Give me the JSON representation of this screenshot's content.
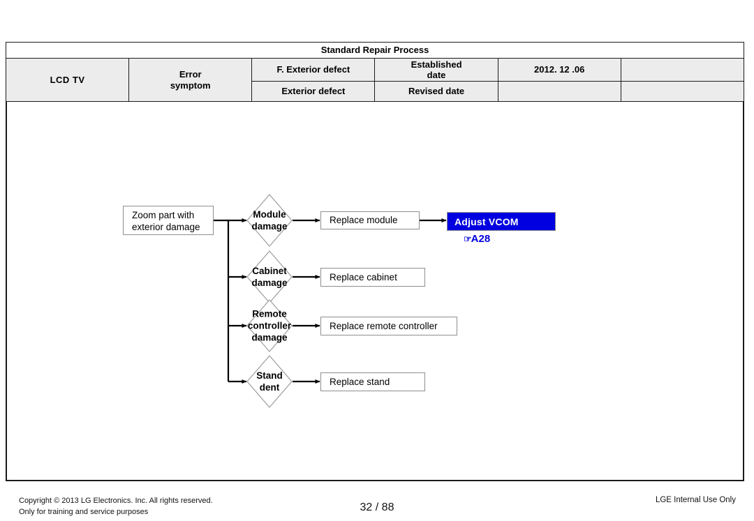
{
  "header": {
    "banner": "Standard Repair Process",
    "product": "LCD  TV",
    "error_symptom": "Error\nsymptom",
    "error_symptom_line1": "Error",
    "error_symptom_line2": "symptom",
    "main_title": "F. Exterior defect",
    "sub_title": "Exterior defect",
    "established_label_line1": "Established",
    "established_label_line2": "date",
    "established_value": "2012. 12 .06",
    "revised_label": "Revised date",
    "revised_value": "",
    "extra_cell_top": "",
    "extra_cell_bottom": ""
  },
  "flowchart": {
    "start": {
      "line1": "Zoom part with",
      "line2": "exterior damage"
    },
    "branches": [
      {
        "decision_line1": "Module",
        "decision_line2": "damage",
        "action": "Replace module"
      },
      {
        "decision_line1": "Cabinet",
        "decision_line2": "damage",
        "action": "Replace cabinet"
      },
      {
        "decision_line1": "Remote",
        "decision_line2": "controller",
        "decision_line3": "damage",
        "action": "Replace remote controller"
      },
      {
        "decision_line1": "Stand",
        "decision_line2": "dent",
        "action": "Replace stand"
      }
    ],
    "highlight": {
      "label": "Adjust VCOM",
      "reference_hand": "☞",
      "reference_code": "A28",
      "color": "#0000e0"
    }
  },
  "footer": {
    "copyright_line1": "Copyright © 2013 LG Electronics. Inc. All rights reserved.",
    "copyright_line2": "Only for training and service purposes",
    "page": "32 / 88",
    "internal_notice": "LGE Internal Use Only"
  }
}
